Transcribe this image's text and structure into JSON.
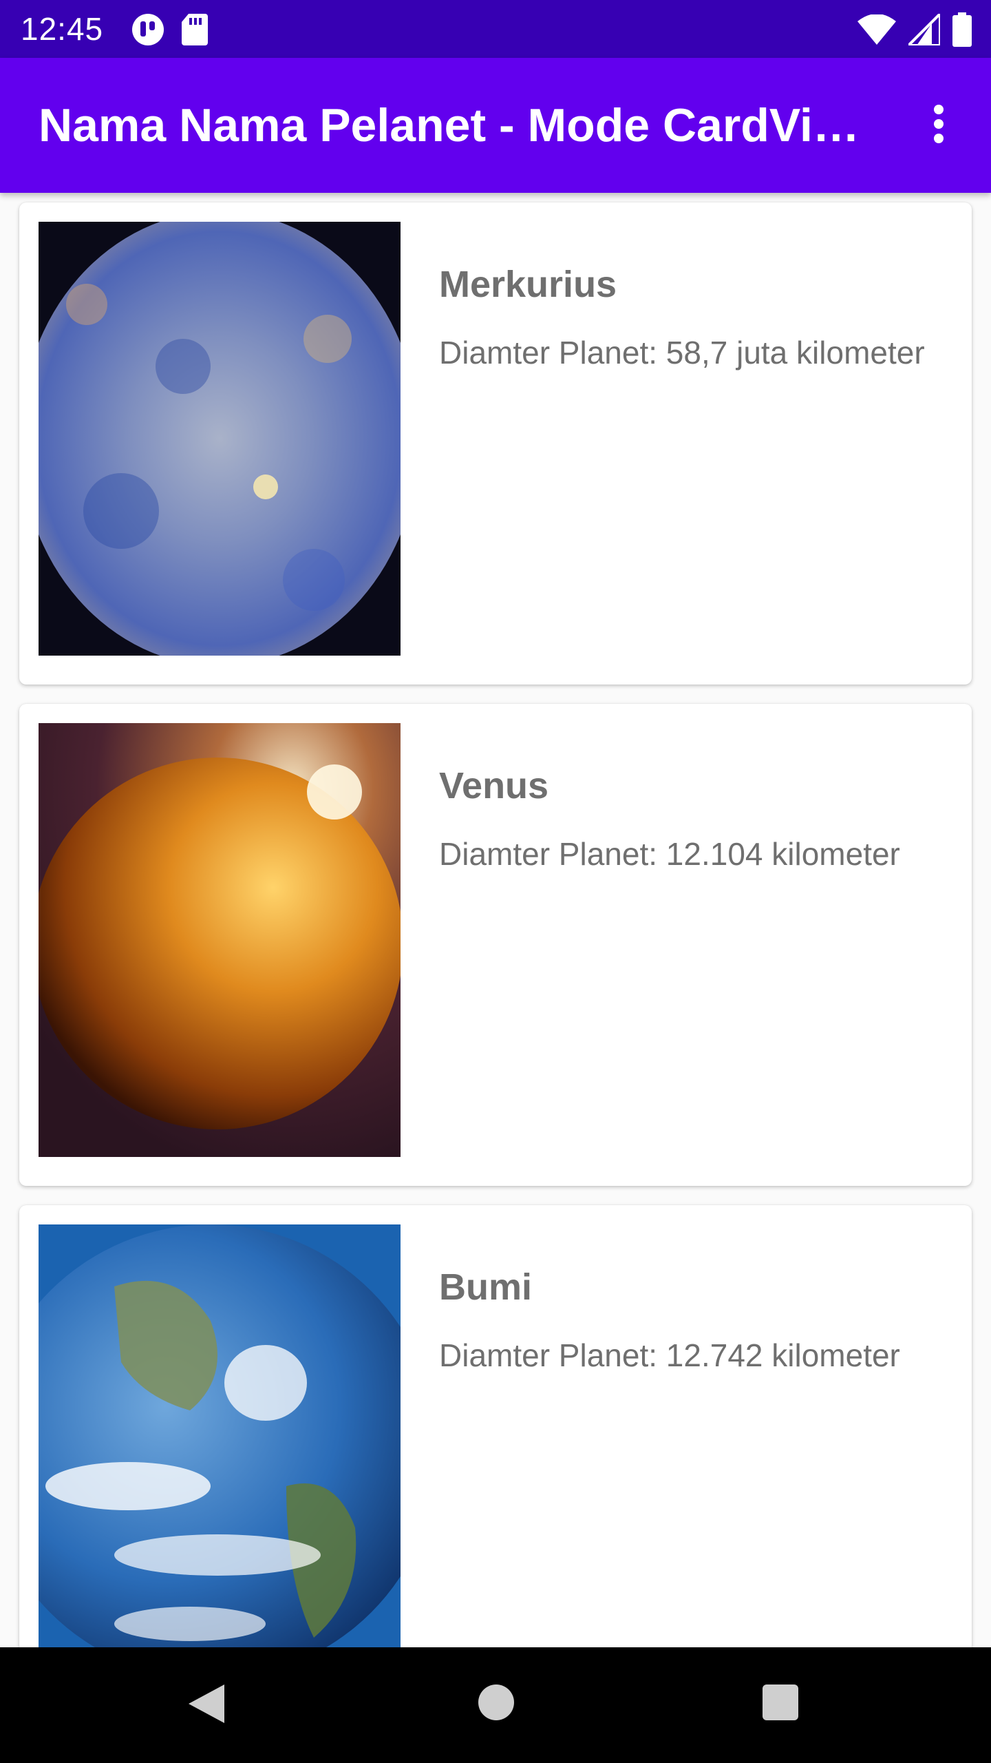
{
  "status_bar": {
    "time": "12:45",
    "left_icons": [
      "data-saver-icon",
      "sd-card-icon"
    ],
    "right_icons": [
      "wifi-icon",
      "signal-icon",
      "battery-icon"
    ]
  },
  "app_bar": {
    "title": "Nama Nama Pelanet - Mode CardVi…",
    "menu_icon": "more-vert-icon"
  },
  "planets": [
    {
      "name": "Merkurius",
      "description": "Diamter Planet: 58,7 juta kilometer"
    },
    {
      "name": "Venus",
      "description": "Diamter Planet: 12.104 kilometer"
    },
    {
      "name": "Bumi",
      "description": "Diamter Planet: 12.742 kilometer"
    }
  ],
  "nav_bar": {
    "icons": [
      "back-icon",
      "home-icon",
      "recents-icon"
    ]
  },
  "colors": {
    "status_bar": "#3700b3",
    "app_bar": "#6200ee",
    "text_secondary": "#6f6f6f"
  }
}
